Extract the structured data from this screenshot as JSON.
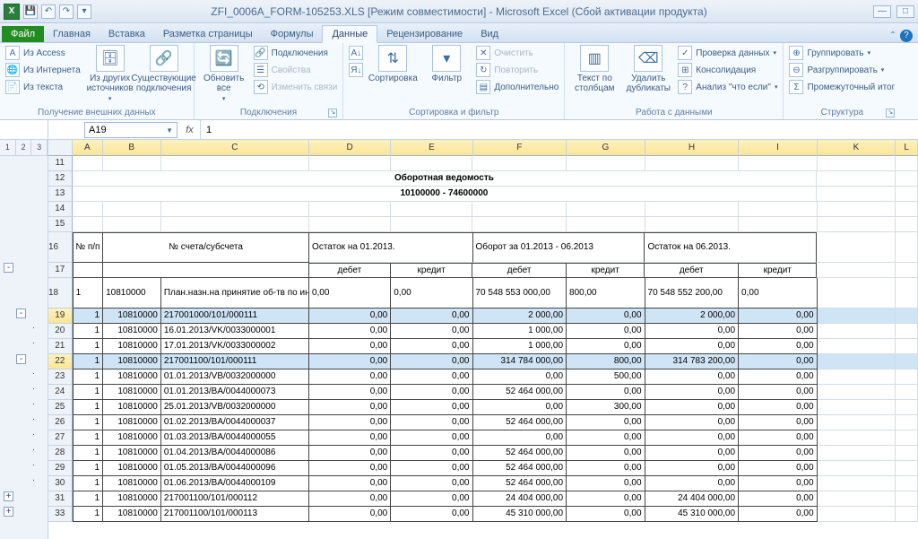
{
  "window": {
    "title": "ZFI_0006A_FORM-105253.XLS  [Режим совместимости]  -  Microsoft Excel (Сбой активации продукта)",
    "qat": {
      "save": "💾",
      "undo": "↶",
      "redo": "↷",
      "more": "▾"
    },
    "controls": {
      "min": "—",
      "max": "□",
      "restore": "□",
      "close": "×"
    }
  },
  "tabs": {
    "file": "Файл",
    "items": [
      "Главная",
      "Вставка",
      "Разметка страницы",
      "Формулы",
      "Данные",
      "Рецензирование",
      "Вид"
    ],
    "activeIndex": 4
  },
  "ribbon": {
    "g0": {
      "label": "Получение внешних данных",
      "access": "Из Access",
      "web": "Из Интернета",
      "text": "Из текста",
      "other": "Из других источников",
      "existing": "Существующие подключения"
    },
    "g1": {
      "label": "Подключения",
      "refresh": "Обновить все",
      "conns": "Подключения",
      "props": "Свойства",
      "editlinks": "Изменить связи"
    },
    "g2": {
      "label": "Сортировка и фильтр",
      "az": "А↓",
      "za": "Я↓",
      "sort": "Сортировка",
      "filter": "Фильтр",
      "clear": "Очистить",
      "reapply": "Повторить",
      "advanced": "Дополнительно"
    },
    "g3": {
      "label": "Работа с данными",
      "t2c": "Текст по столбцам",
      "dedup": "Удалить дубликаты",
      "valid": "Проверка данных",
      "consol": "Консолидация",
      "whatif": "Анализ \"что если\""
    },
    "g4": {
      "label": "Структура",
      "group": "Группировать",
      "ungroup": "Разгруппировать",
      "subtotal": "Промежуточный итог"
    }
  },
  "namebox": "A19",
  "formula": "1",
  "fx": "fx",
  "outline_head": [
    "1",
    "2",
    "3"
  ],
  "cols": [
    "A",
    "B",
    "C",
    "D",
    "E",
    "F",
    "G",
    "H",
    "I",
    "K",
    "L"
  ],
  "header_rows": {
    "title": "Оборотная ведомость",
    "subtitle": "10100000 - 74600000",
    "h_np": "№ п/п",
    "h_acc": "№ счета/субсчета",
    "h_start": "Остаток на 01.2013.",
    "h_turn": "Оборот за  01.2013 - 06.2013",
    "h_end": "Остаток на 06.2013.",
    "h_dr": "дебет",
    "h_cr": "кредит"
  },
  "rowmeta": [
    {
      "rn": "11"
    },
    {
      "rn": "12"
    },
    {
      "rn": "13"
    },
    {
      "rn": "14"
    },
    {
      "rn": "15"
    }
  ],
  "rows": [
    {
      "rn": "18",
      "a": "1",
      "b": "10810000",
      "c": "План.назн.на принятие об-тв по индив.плану финан.",
      "d": "0,00",
      "e": "0,00",
      "f": "70 548 553 000,00",
      "g": "800,00",
      "h": "70 548 552 200,00",
      "i": "0,00",
      "tall": true
    },
    {
      "rn": "19",
      "a": "1",
      "b": "10810000",
      "c": "217001000/101/000111",
      "d": "0,00",
      "e": "0,00",
      "f": "2 000,00",
      "g": "0,00",
      "h": "2 000,00",
      "i": "0,00",
      "sel": true
    },
    {
      "rn": "20",
      "a": "1",
      "b": "10810000",
      "c": "16.01.2013/VK/0033000001",
      "d": "0,00",
      "e": "0,00",
      "f": "1 000,00",
      "g": "0,00",
      "h": "0,00",
      "i": "0,00"
    },
    {
      "rn": "21",
      "a": "1",
      "b": "10810000",
      "c": "17.01.2013/VK/0033000002",
      "d": "0,00",
      "e": "0,00",
      "f": "1 000,00",
      "g": "0,00",
      "h": "0,00",
      "i": "0,00"
    },
    {
      "rn": "22",
      "a": "1",
      "b": "10810000",
      "c": "217001100/101/000111",
      "d": "0,00",
      "e": "0,00",
      "f": "314 784 000,00",
      "g": "800,00",
      "h": "314 783 200,00",
      "i": "0,00",
      "sel": true
    },
    {
      "rn": "23",
      "a": "1",
      "b": "10810000",
      "c": "01.01.2013/VB/0032000000",
      "d": "0,00",
      "e": "0,00",
      "f": "0,00",
      "g": "500,00",
      "h": "0,00",
      "i": "0,00"
    },
    {
      "rn": "24",
      "a": "1",
      "b": "10810000",
      "c": "01.01.2013/BA/0044000073",
      "d": "0,00",
      "e": "0,00",
      "f": "52 464 000,00",
      "g": "0,00",
      "h": "0,00",
      "i": "0,00"
    },
    {
      "rn": "25",
      "a": "1",
      "b": "10810000",
      "c": "25.01.2013/VB/0032000000",
      "d": "0,00",
      "e": "0,00",
      "f": "0,00",
      "g": "300,00",
      "h": "0,00",
      "i": "0,00"
    },
    {
      "rn": "26",
      "a": "1",
      "b": "10810000",
      "c": "01.02.2013/BA/0044000037",
      "d": "0,00",
      "e": "0,00",
      "f": "52 464 000,00",
      "g": "0,00",
      "h": "0,00",
      "i": "0,00"
    },
    {
      "rn": "27",
      "a": "1",
      "b": "10810000",
      "c": "01.03.2013/BA/0044000055",
      "d": "0,00",
      "e": "0,00",
      "f": "0,00",
      "g": "0,00",
      "h": "0,00",
      "i": "0,00"
    },
    {
      "rn": "28",
      "a": "1",
      "b": "10810000",
      "c": "01.04.2013/BA/0044000086",
      "d": "0,00",
      "e": "0,00",
      "f": "52 464 000,00",
      "g": "0,00",
      "h": "0,00",
      "i": "0,00"
    },
    {
      "rn": "29",
      "a": "1",
      "b": "10810000",
      "c": "01.05.2013/BA/0044000096",
      "d": "0,00",
      "e": "0,00",
      "f": "52 464 000,00",
      "g": "0,00",
      "h": "0,00",
      "i": "0,00"
    },
    {
      "rn": "30",
      "a": "1",
      "b": "10810000",
      "c": "01.06.2013/BA/0044000109",
      "d": "0,00",
      "e": "0,00",
      "f": "52 464 000,00",
      "g": "0,00",
      "h": "0,00",
      "i": "0,00"
    },
    {
      "rn": "31",
      "a": "1",
      "b": "10810000",
      "c": "217001100/101/000112",
      "d": "0,00",
      "e": "0,00",
      "f": "24 404 000,00",
      "g": "0,00",
      "h": "24 404 000,00",
      "i": "0,00"
    },
    {
      "rn": "33",
      "a": "1",
      "b": "10810000",
      "c": "217001100/101/000113",
      "d": "0,00",
      "e": "0,00",
      "f": "45 310 000,00",
      "g": "0,00",
      "h": "45 310 000,00",
      "i": "0,00"
    }
  ],
  "header_rownums": {
    "r16": "16",
    "r17": "17"
  }
}
